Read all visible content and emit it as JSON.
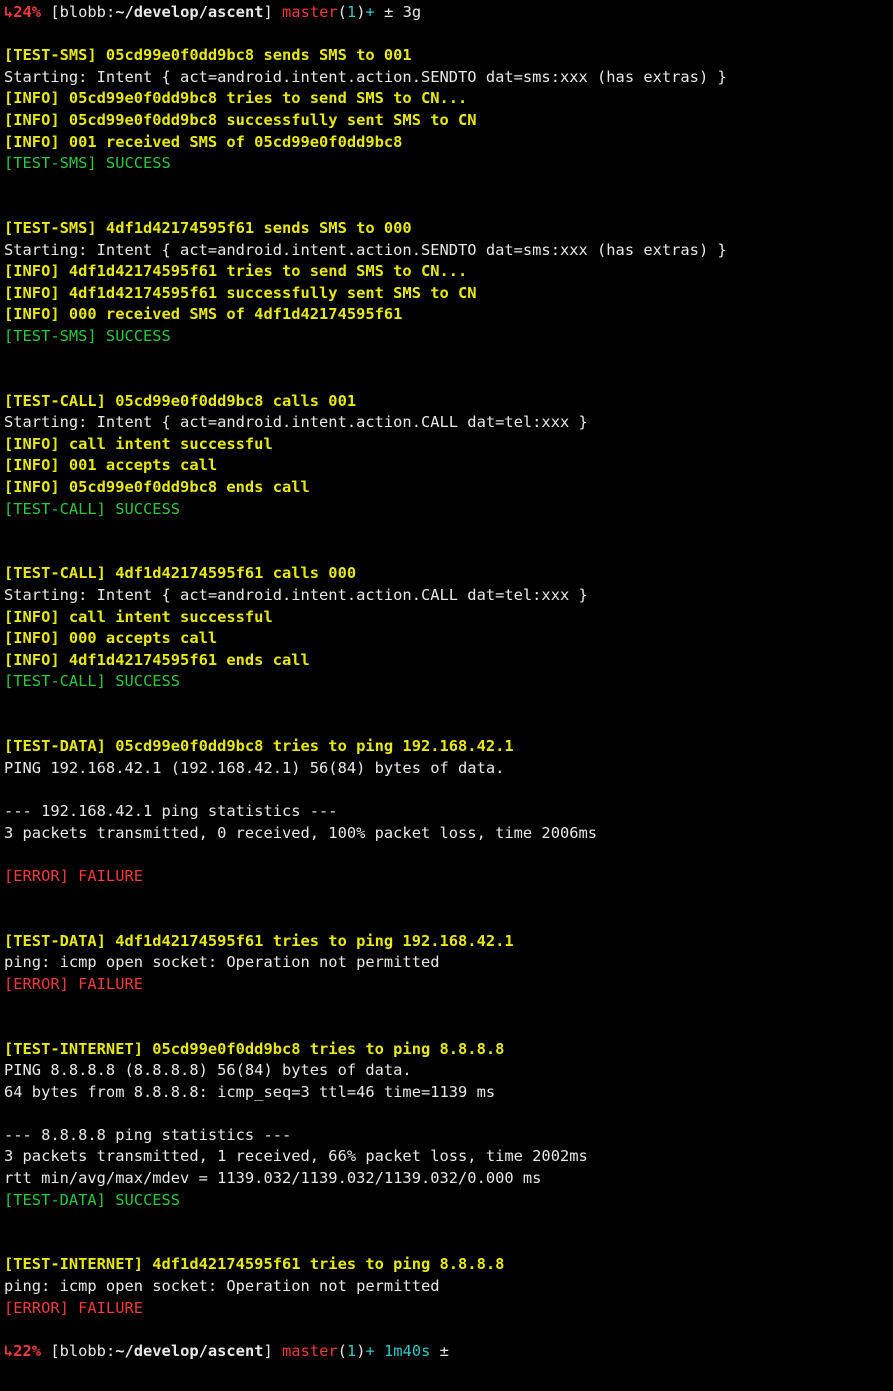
{
  "lines": [
    [
      {
        "cls": "bold red",
        "t": "↳24%"
      },
      {
        "cls": "",
        "t": " [blobb:"
      },
      {
        "cls": "bold white",
        "t": "~/develop/ascent"
      },
      {
        "cls": "",
        "t": "] "
      },
      {
        "cls": "red",
        "t": "master"
      },
      {
        "cls": "",
        "t": "("
      },
      {
        "cls": "cyan",
        "t": "1"
      },
      {
        "cls": "",
        "t": ")"
      },
      {
        "cls": "cyan",
        "t": "+"
      },
      {
        "cls": "",
        "t": " ± 3g"
      }
    ],
    [
      {
        "cls": "",
        "t": ""
      }
    ],
    [
      {
        "cls": "bold yellow",
        "t": "[TEST-SMS] 05cd99e0f0dd9bc8 sends SMS to 001"
      }
    ],
    [
      {
        "cls": "white",
        "t": "Starting: Intent { act=android.intent.action.SENDTO dat=sms:xxx (has extras) }"
      }
    ],
    [
      {
        "cls": "bold yellow",
        "t": "[INFO] 05cd99e0f0dd9bc8 tries to send SMS to CN..."
      }
    ],
    [
      {
        "cls": "bold yellow",
        "t": "[INFO] 05cd99e0f0dd9bc8 successfully sent SMS to CN"
      }
    ],
    [
      {
        "cls": "bold yellow",
        "t": "[INFO] 001 received SMS of 05cd99e0f0dd9bc8"
      }
    ],
    [
      {
        "cls": "green",
        "t": "[TEST-SMS] SUCCESS"
      }
    ],
    [
      {
        "cls": "",
        "t": ""
      }
    ],
    [
      {
        "cls": "",
        "t": ""
      }
    ],
    [
      {
        "cls": "bold yellow",
        "t": "[TEST-SMS] 4df1d42174595f61 sends SMS to 000"
      }
    ],
    [
      {
        "cls": "white",
        "t": "Starting: Intent { act=android.intent.action.SENDTO dat=sms:xxx (has extras) }"
      }
    ],
    [
      {
        "cls": "bold yellow",
        "t": "[INFO] 4df1d42174595f61 tries to send SMS to CN..."
      }
    ],
    [
      {
        "cls": "bold yellow",
        "t": "[INFO] 4df1d42174595f61 successfully sent SMS to CN"
      }
    ],
    [
      {
        "cls": "bold yellow",
        "t": "[INFO] 000 received SMS of 4df1d42174595f61"
      }
    ],
    [
      {
        "cls": "green",
        "t": "[TEST-SMS] SUCCESS"
      }
    ],
    [
      {
        "cls": "",
        "t": ""
      }
    ],
    [
      {
        "cls": "",
        "t": ""
      }
    ],
    [
      {
        "cls": "bold yellow",
        "t": "[TEST-CALL] 05cd99e0f0dd9bc8 calls 001"
      }
    ],
    [
      {
        "cls": "white",
        "t": "Starting: Intent { act=android.intent.action.CALL dat=tel:xxx }"
      }
    ],
    [
      {
        "cls": "bold yellow",
        "t": "[INFO] call intent successful"
      }
    ],
    [
      {
        "cls": "bold yellow",
        "t": "[INFO] 001 accepts call"
      }
    ],
    [
      {
        "cls": "bold yellow",
        "t": "[INFO] 05cd99e0f0dd9bc8 ends call"
      }
    ],
    [
      {
        "cls": "green",
        "t": "[TEST-CALL] SUCCESS"
      }
    ],
    [
      {
        "cls": "",
        "t": ""
      }
    ],
    [
      {
        "cls": "",
        "t": ""
      }
    ],
    [
      {
        "cls": "bold yellow",
        "t": "[TEST-CALL] 4df1d42174595f61 calls 000"
      }
    ],
    [
      {
        "cls": "white",
        "t": "Starting: Intent { act=android.intent.action.CALL dat=tel:xxx }"
      }
    ],
    [
      {
        "cls": "bold yellow",
        "t": "[INFO] call intent successful"
      }
    ],
    [
      {
        "cls": "bold yellow",
        "t": "[INFO] 000 accepts call"
      }
    ],
    [
      {
        "cls": "bold yellow",
        "t": "[INFO] 4df1d42174595f61 ends call"
      }
    ],
    [
      {
        "cls": "green",
        "t": "[TEST-CALL] SUCCESS"
      }
    ],
    [
      {
        "cls": "",
        "t": ""
      }
    ],
    [
      {
        "cls": "",
        "t": ""
      }
    ],
    [
      {
        "cls": "bold yellow",
        "t": "[TEST-DATA] 05cd99e0f0dd9bc8 tries to ping 192.168.42.1"
      }
    ],
    [
      {
        "cls": "white",
        "t": "PING 192.168.42.1 (192.168.42.1) 56(84) bytes of data."
      }
    ],
    [
      {
        "cls": "",
        "t": ""
      }
    ],
    [
      {
        "cls": "white",
        "t": "--- 192.168.42.1 ping statistics ---"
      }
    ],
    [
      {
        "cls": "white",
        "t": "3 packets transmitted, 0 received, 100% packet loss, time 2006ms"
      }
    ],
    [
      {
        "cls": "",
        "t": ""
      }
    ],
    [
      {
        "cls": "red",
        "t": "[ERROR] FAILURE"
      }
    ],
    [
      {
        "cls": "",
        "t": ""
      }
    ],
    [
      {
        "cls": "",
        "t": ""
      }
    ],
    [
      {
        "cls": "bold yellow",
        "t": "[TEST-DATA] 4df1d42174595f61 tries to ping 192.168.42.1"
      }
    ],
    [
      {
        "cls": "white",
        "t": "ping: icmp open socket: Operation not permitted"
      }
    ],
    [
      {
        "cls": "red",
        "t": "[ERROR] FAILURE"
      }
    ],
    [
      {
        "cls": "",
        "t": ""
      }
    ],
    [
      {
        "cls": "",
        "t": ""
      }
    ],
    [
      {
        "cls": "bold yellow",
        "t": "[TEST-INTERNET] 05cd99e0f0dd9bc8 tries to ping 8.8.8.8"
      }
    ],
    [
      {
        "cls": "white",
        "t": "PING 8.8.8.8 (8.8.8.8) 56(84) bytes of data."
      }
    ],
    [
      {
        "cls": "white",
        "t": "64 bytes from 8.8.8.8: icmp_seq=3 ttl=46 time=1139 ms"
      }
    ],
    [
      {
        "cls": "",
        "t": ""
      }
    ],
    [
      {
        "cls": "white",
        "t": "--- 8.8.8.8 ping statistics ---"
      }
    ],
    [
      {
        "cls": "white",
        "t": "3 packets transmitted, 1 received, 66% packet loss, time 2002ms"
      }
    ],
    [
      {
        "cls": "white",
        "t": "rtt min/avg/max/mdev = 1139.032/1139.032/1139.032/0.000 ms"
      }
    ],
    [
      {
        "cls": "green",
        "t": "[TEST-DATA] SUCCESS"
      }
    ],
    [
      {
        "cls": "",
        "t": ""
      }
    ],
    [
      {
        "cls": "",
        "t": ""
      }
    ],
    [
      {
        "cls": "bold yellow",
        "t": "[TEST-INTERNET] 4df1d42174595f61 tries to ping 8.8.8.8"
      }
    ],
    [
      {
        "cls": "white",
        "t": "ping: icmp open socket: Operation not permitted"
      }
    ],
    [
      {
        "cls": "red",
        "t": "[ERROR] FAILURE"
      }
    ],
    [
      {
        "cls": "",
        "t": ""
      }
    ],
    [
      {
        "cls": "bold red",
        "t": "↳22%"
      },
      {
        "cls": "",
        "t": " [blobb:"
      },
      {
        "cls": "bold white",
        "t": "~/develop/ascent"
      },
      {
        "cls": "",
        "t": "] "
      },
      {
        "cls": "red",
        "t": "master"
      },
      {
        "cls": "",
        "t": "("
      },
      {
        "cls": "cyan",
        "t": "1"
      },
      {
        "cls": "",
        "t": ")"
      },
      {
        "cls": "cyan",
        "t": "+ 1m40s"
      },
      {
        "cls": "",
        "t": " ±"
      }
    ]
  ]
}
